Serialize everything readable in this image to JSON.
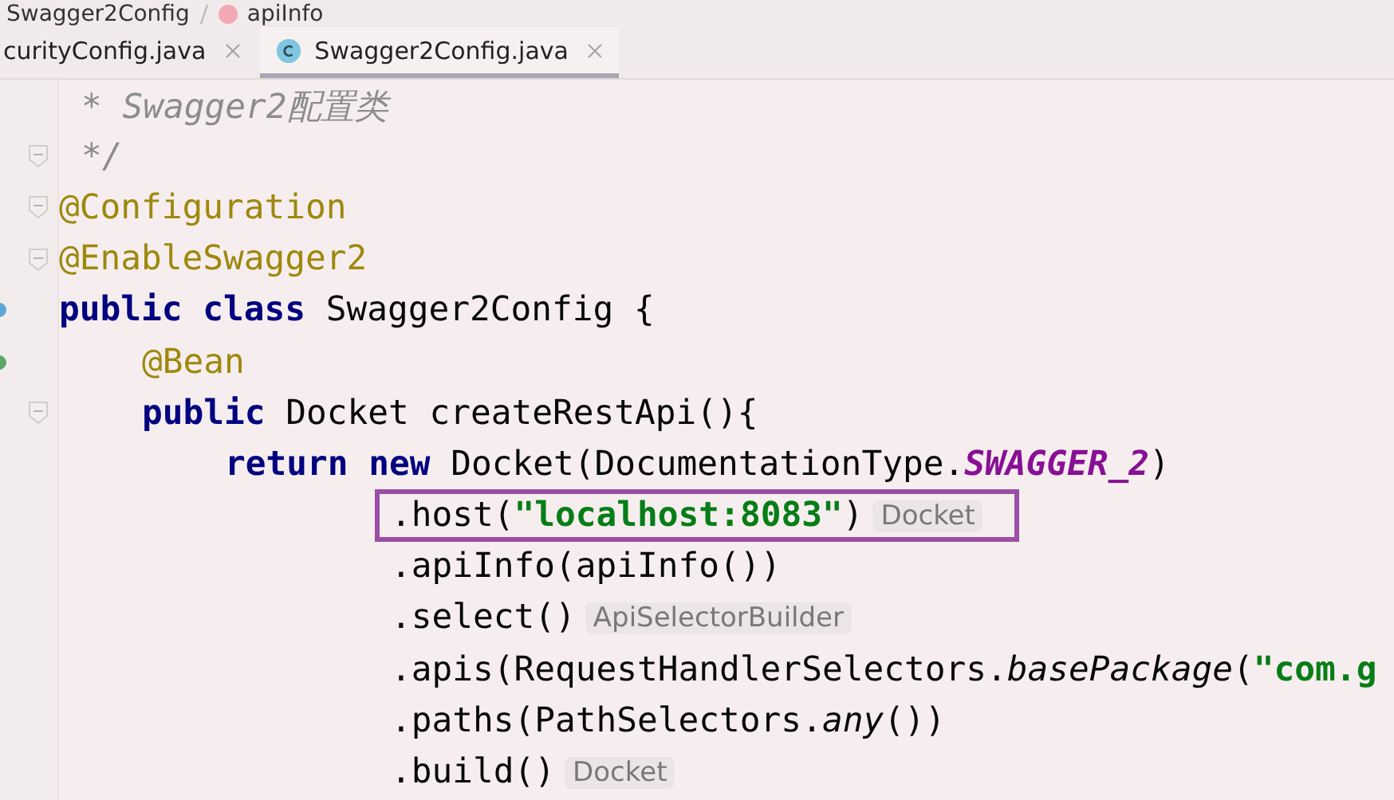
{
  "breadcrumb": [
    {
      "label": "Swagger2Config",
      "kind": "plain"
    },
    {
      "label": "apiInfo",
      "kind": "method"
    }
  ],
  "tabs": [
    {
      "label": "curityConfig.java",
      "selected": false,
      "kind": "plain"
    },
    {
      "label": "Swagger2Config.java",
      "selected": true,
      "kind": "class"
    }
  ],
  "code_lines": [
    {
      "kind": "doc-comment",
      "fold": false,
      "highlighted": false,
      "tokens": [
        {
          "text": "* Swagger2配置类",
          "kind": "comment"
        }
      ]
    },
    {
      "kind": "doc-comment",
      "fold": true,
      "highlighted": false,
      "tokens": [
        {
          "text": "*/",
          "kind": "comment"
        }
      ]
    },
    {
      "kind": "declaration",
      "fold": true,
      "highlighted": false,
      "tokens": [
        {
          "text": "@Configuration",
          "kind": "annotation"
        }
      ]
    },
    {
      "kind": "declaration",
      "fold": true,
      "highlighted": false,
      "tokens": [
        {
          "text": "@EnableSwagger2",
          "kind": "annotation"
        }
      ]
    },
    {
      "kind": "declaration",
      "fold": false,
      "highlighted": false,
      "color": "#5aa7d6",
      "tokens": [
        {
          "text": "public class",
          "kind": "keyword"
        },
        {
          "text": "Swagger2Config {",
          "kind": "plain"
        }
      ]
    },
    {
      "kind": "member",
      "fold": false,
      "highlighted": false,
      "color": "#59a869",
      "tokens": [
        {
          "text": "@Bean",
          "kind": "annotation"
        }
      ]
    },
    {
      "kind": "member",
      "fold": true,
      "highlighted": false,
      "tokens": [
        {
          "text": "public",
          "kind": "keyword"
        },
        {
          "text": "Docket createRestApi(){",
          "kind": "plain"
        }
      ]
    },
    {
      "kind": "statement",
      "fold": false,
      "highlighted": false,
      "tokens": [
        {
          "text": "return new",
          "kind": "keyword"
        },
        {
          "text": "Docket(DocumentationType.",
          "kind": "plain"
        },
        {
          "text": "SWAGGER_2",
          "kind": "constant"
        },
        {
          "text": ")",
          "kind": "plain"
        }
      ]
    },
    {
      "kind": "chain",
      "fold": false,
      "highlighted": true,
      "tokens": [
        {
          "text": ".host(",
          "kind": "plain"
        },
        {
          "text": "\"localhost:8083\"",
          "kind": "string"
        },
        {
          "text": ")",
          "kind": "plain"
        },
        {
          "text": "Docket",
          "kind": "hint"
        }
      ]
    },
    {
      "kind": "chain",
      "fold": false,
      "highlighted": false,
      "tokens": [
        {
          "text": ".apiInfo(apiInfo())",
          "kind": "plain"
        }
      ]
    },
    {
      "kind": "chain",
      "fold": false,
      "highlighted": false,
      "tokens": [
        {
          "text": ".select()",
          "kind": "plain"
        },
        {
          "text": "ApiSelectorBuilder",
          "kind": "hint"
        }
      ]
    },
    {
      "kind": "chain",
      "fold": false,
      "highlighted": false,
      "tokens": [
        {
          "text": ".apis(RequestHandlerSelectors.",
          "kind": "plain"
        },
        {
          "text": "basePackage",
          "kind": "italic"
        },
        {
          "text": "(",
          "kind": "plain"
        },
        {
          "text": "\"com.g",
          "kind": "string"
        }
      ]
    },
    {
      "kind": "chain",
      "fold": false,
      "highlighted": false,
      "tokens": [
        {
          "text": ".paths(PathSelectors.",
          "kind": "plain"
        },
        {
          "text": "any",
          "kind": "italic"
        },
        {
          "text": "())",
          "kind": "plain"
        }
      ]
    },
    {
      "kind": "chain",
      "fold": false,
      "highlighted": false,
      "tokens": [
        {
          "text": ".build()",
          "kind": "plain"
        },
        {
          "text": "Docket",
          "kind": "hint"
        }
      ]
    }
  ]
}
